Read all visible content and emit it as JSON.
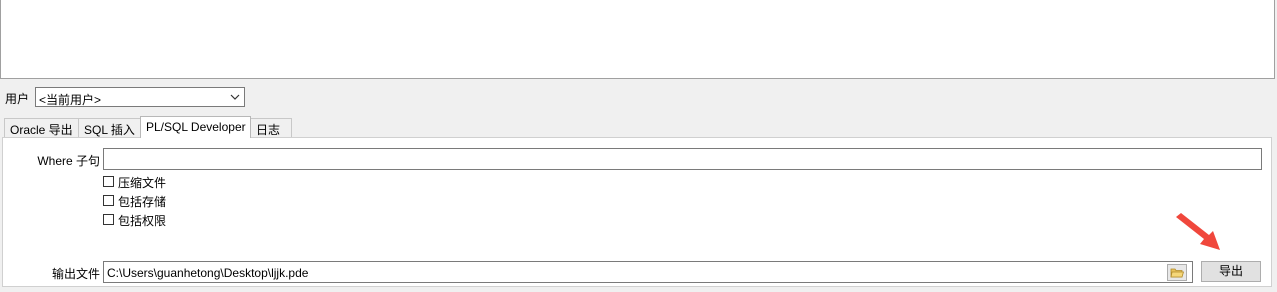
{
  "user_row": {
    "label": "用户",
    "selected": "<当前用户>"
  },
  "tabs": [
    {
      "label": "Oracle 导出",
      "active": false
    },
    {
      "label": "SQL 插入",
      "active": false
    },
    {
      "label": "PL/SQL Developer",
      "active": true
    },
    {
      "label": "日志",
      "active": false
    }
  ],
  "panel": {
    "where_label": "Where 子句",
    "where_value": "",
    "checkboxes": [
      {
        "label": "压缩文件",
        "checked": false
      },
      {
        "label": "包括存储",
        "checked": false
      },
      {
        "label": "包括权限",
        "checked": false
      }
    ],
    "output_label": "输出文件",
    "output_value": "C:\\Users\\guanhetong\\Desktop\\ljjk.pde",
    "export_label": "导出"
  },
  "icons": {
    "folder": "folder-open-icon",
    "dropdown": "chevron-down-icon",
    "annotation": "red-arrow-icon"
  },
  "colors": {
    "window_bg": "#f0f0f0",
    "arrow": "#f0473c"
  }
}
